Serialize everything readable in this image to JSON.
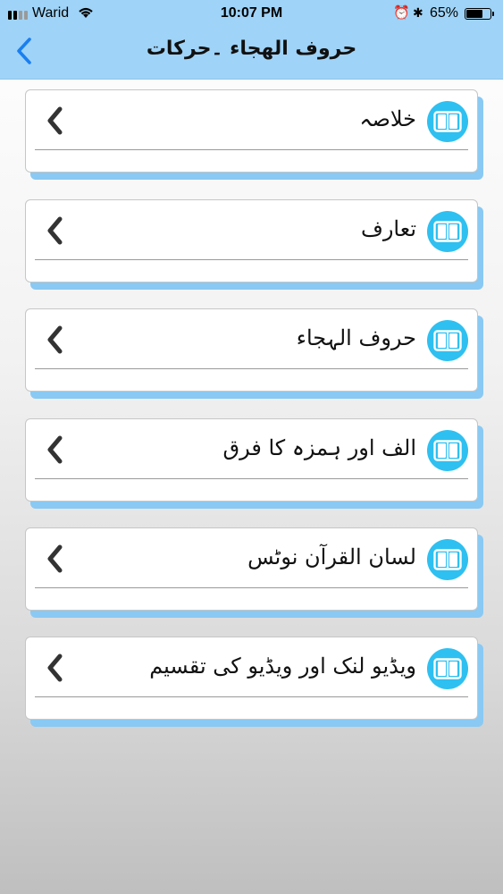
{
  "status_bar": {
    "carrier": "Warid",
    "time": "10:07 PM",
    "battery_percent": "65%",
    "battery_level": 0.65,
    "icons": [
      "signal-icon",
      "wifi-icon",
      "alarm-icon",
      "bluetooth-icon",
      "battery-icon"
    ]
  },
  "nav": {
    "back_icon": "chevron-left-icon",
    "title": "حروف الهجاء ۔حرکات"
  },
  "items": [
    {
      "label": "خلاصہ",
      "icon": "book-icon"
    },
    {
      "label": "تعارف",
      "icon": "book-icon"
    },
    {
      "label": "حروف الہجاء",
      "icon": "book-icon"
    },
    {
      "label": "الف اور ہمزہ کا فرق",
      "icon": "book-icon"
    },
    {
      "label": "لسان القرآن نوٹس",
      "icon": "book-icon"
    },
    {
      "label": "ویڈیو لنک اور ویڈیو کی تقسیم",
      "icon": "book-icon"
    }
  ],
  "colors": {
    "header": "#9fd3f7",
    "accent": "#2ec0f0",
    "back_arrow": "#1a7ff0",
    "card_shadow": "#89c9f3"
  }
}
